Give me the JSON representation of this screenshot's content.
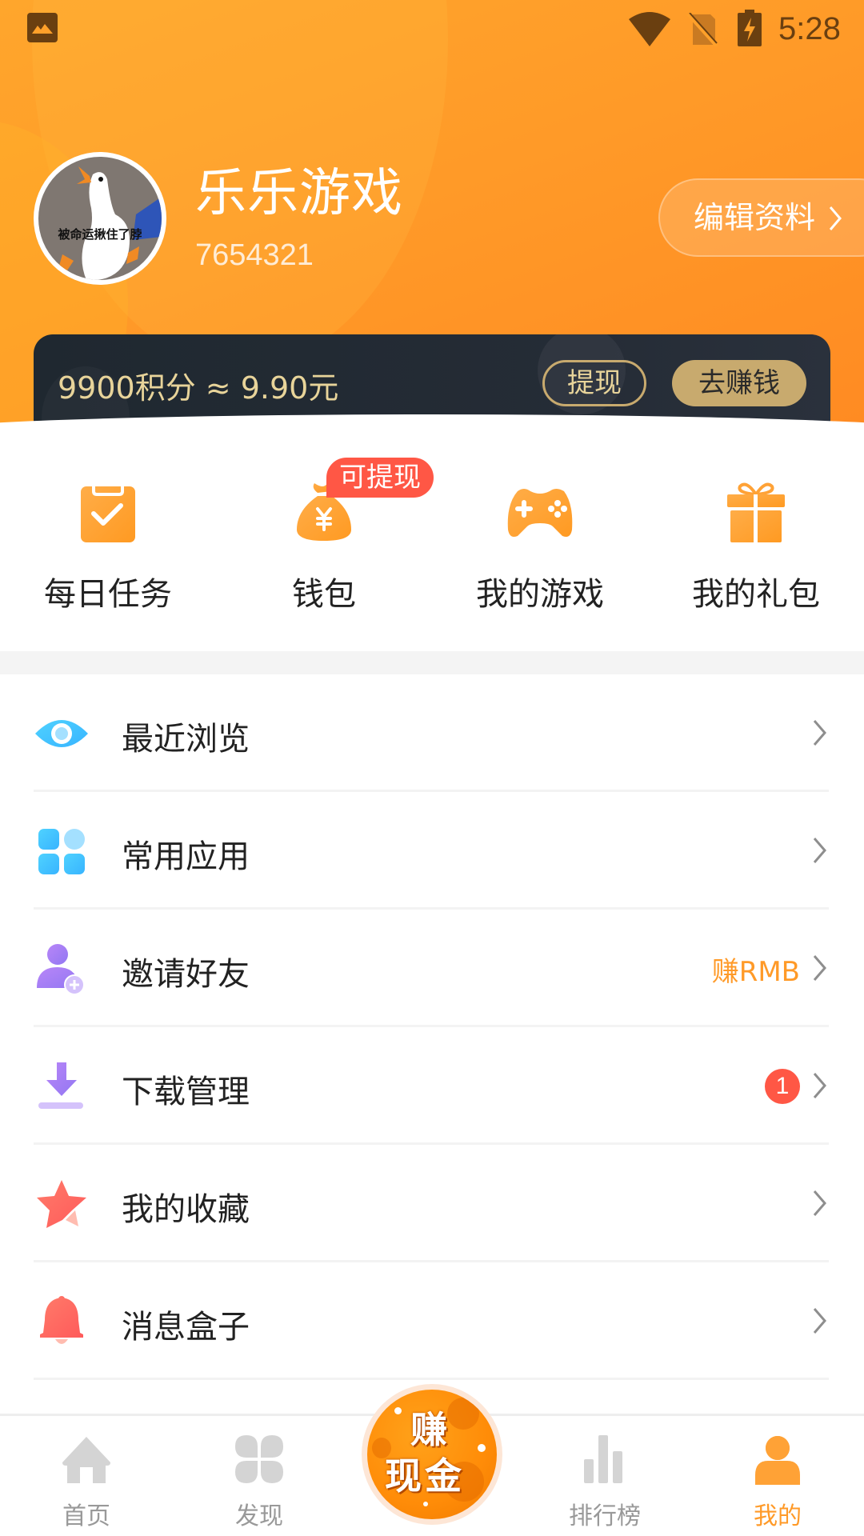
{
  "status_bar": {
    "time": "5:28",
    "icons": [
      "gallery-icon",
      "wifi-icon",
      "no-sim-icon",
      "battery-charging-icon"
    ]
  },
  "profile": {
    "name": "乐乐游戏",
    "user_id": "7654321",
    "avatar_caption": "被命运揪住了脖",
    "edit_label": "编辑资料",
    "edit_chevron": "›"
  },
  "points_card": {
    "text": "9900积分 ≈ 9.90元",
    "points": 9900,
    "cash_value": "9.90元",
    "withdraw_label": "提现",
    "earn_label": "去赚钱"
  },
  "quick_actions": [
    {
      "label": "每日任务",
      "icon": "clipboard-check-icon"
    },
    {
      "label": "钱包",
      "icon": "money-bag-icon",
      "badge": "可提现"
    },
    {
      "label": "我的游戏",
      "icon": "gamepad-icon"
    },
    {
      "label": "我的礼包",
      "icon": "gift-icon"
    }
  ],
  "menu": [
    {
      "label": "最近浏览",
      "icon": "eye-icon"
    },
    {
      "label": "常用应用",
      "icon": "apps-grid-icon"
    },
    {
      "label": "邀请好友",
      "icon": "add-user-icon",
      "extra": "赚RMB"
    },
    {
      "label": "下载管理",
      "icon": "download-icon",
      "count": "1"
    },
    {
      "label": "我的收藏",
      "icon": "star-icon"
    },
    {
      "label": "消息盒子",
      "icon": "bell-icon"
    }
  ],
  "bottom_nav": {
    "items": [
      {
        "label": "首页",
        "icon": "home-icon",
        "active": false
      },
      {
        "label": "发现",
        "icon": "discover-icon",
        "active": false
      },
      {
        "label": "排行榜",
        "icon": "ranking-icon",
        "active": false
      },
      {
        "label": "我的",
        "icon": "profile-icon",
        "active": true
      }
    ],
    "center_button": {
      "line1": "赚",
      "line2": "现金"
    }
  },
  "colors": {
    "brand_orange": "#ff9a28",
    "badge_red": "#ff5745",
    "gold": "#c8aa6e",
    "gold_text": "#e8d49a",
    "card_dark": "#222a33"
  }
}
